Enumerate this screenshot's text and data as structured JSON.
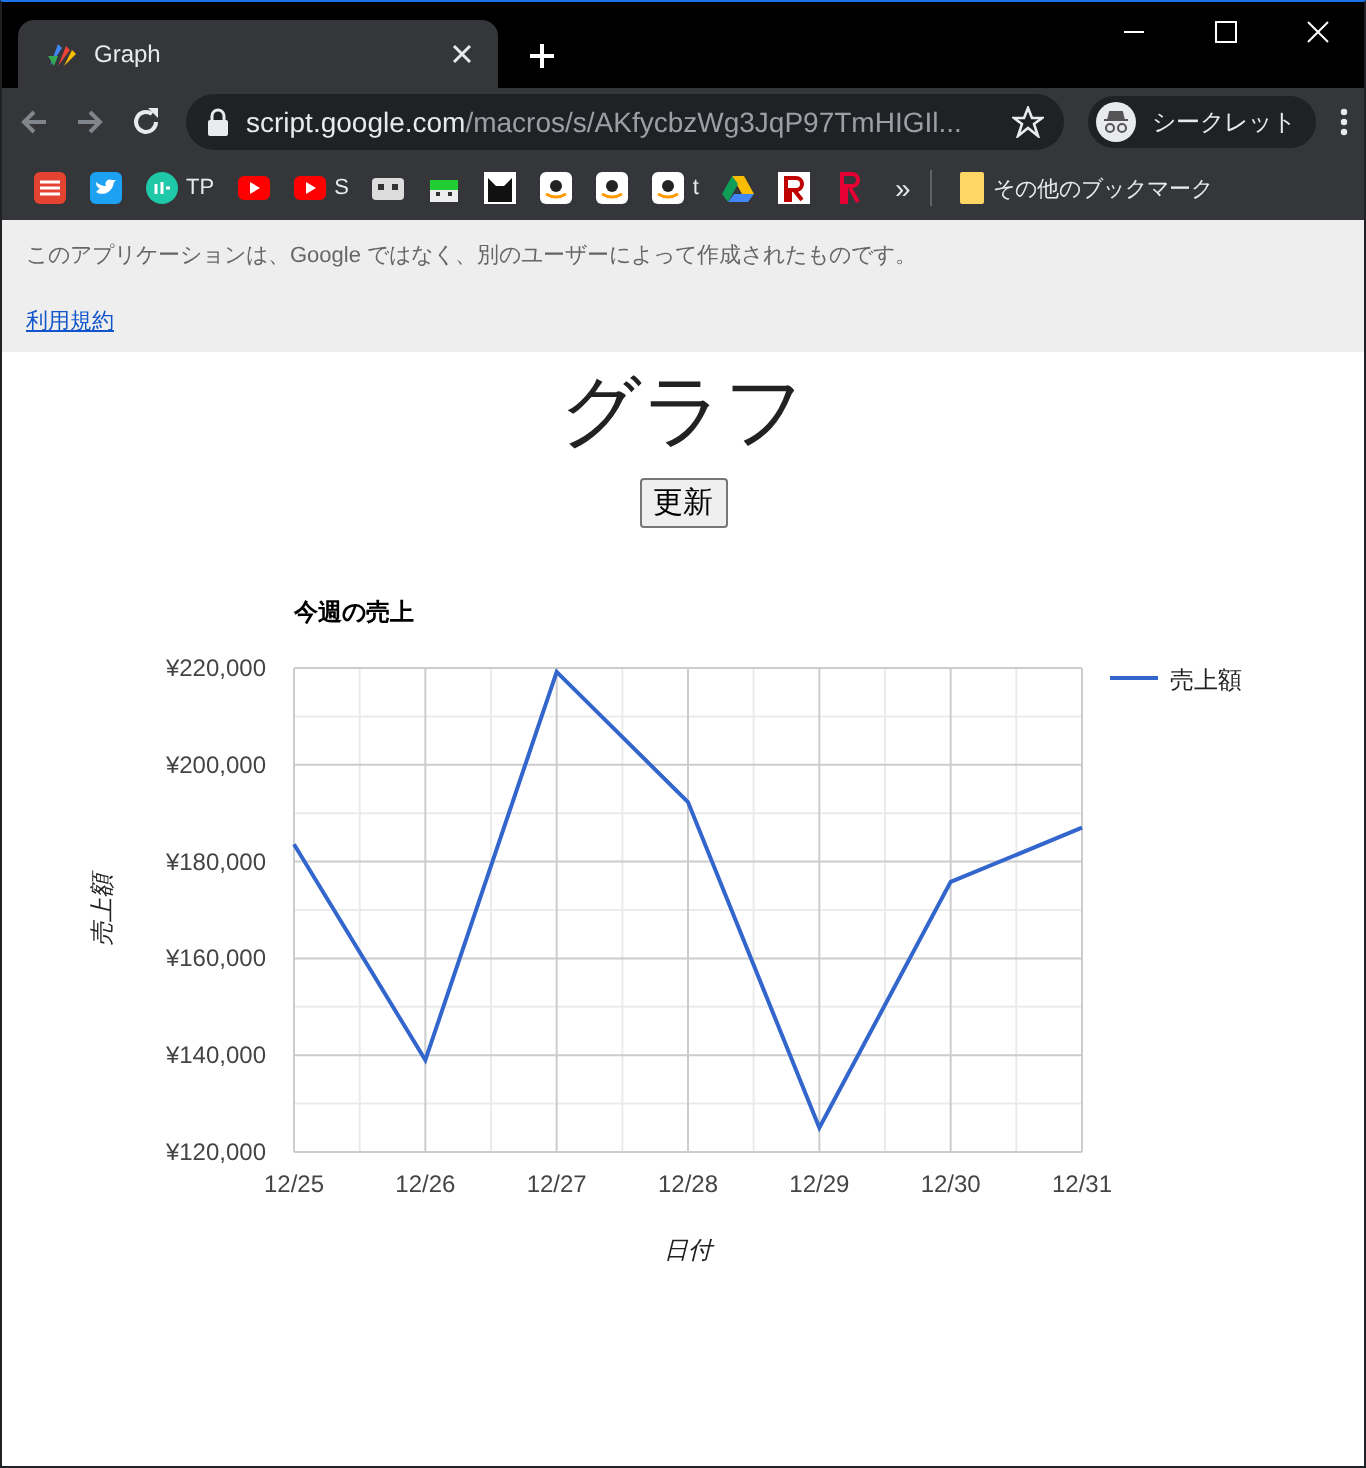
{
  "browser": {
    "tab": {
      "title": "Graph",
      "selected": true
    },
    "address": {
      "host": "script.google.com",
      "path": "/macros/s/AKfycbzWg3JqP97TmHIGIl..."
    },
    "profile": "シークレット",
    "bookmarks": [
      {
        "kind": "list"
      },
      {
        "kind": "bird"
      },
      {
        "kind": "ito",
        "label": "TP"
      },
      {
        "kind": "play"
      },
      {
        "kind": "play",
        "label": "S"
      },
      {
        "kind": "tv"
      },
      {
        "kind": "robot"
      },
      {
        "kind": "cat"
      },
      {
        "kind": "smile"
      },
      {
        "kind": "smile"
      },
      {
        "kind": "smile",
        "label": "t"
      },
      {
        "kind": "drive"
      },
      {
        "kind": "r"
      },
      {
        "kind": "r2"
      }
    ],
    "overflow": "»",
    "other_bookmarks": "その他のブックマーク"
  },
  "notice": {
    "text": "このアプリケーションは、Google ではなく、別のユーザーによって作成されたものです。",
    "link": "利用規約"
  },
  "page": {
    "heading": "グラフ",
    "button": "更新",
    "chart_data": {
      "type": "line",
      "title": "今週の売上",
      "xlabel": "日付",
      "ylabel": "売上額",
      "categories": [
        "12/25",
        "12/26",
        "12/27",
        "12/28",
        "12/29",
        "12/30",
        "12/31"
      ],
      "series": [
        {
          "name": "売上額",
          "color": "#3366cc",
          "values": [
            183600,
            139000,
            219200,
            192300,
            125000,
            175800,
            187000
          ]
        }
      ],
      "ylim": [
        120000,
        220000
      ],
      "grid": true,
      "yticks": [
        {
          "value": 120000,
          "label": "¥120,000"
        },
        {
          "value": 140000,
          "label": "¥140,000"
        },
        {
          "value": 160000,
          "label": "¥160,000"
        },
        {
          "value": 180000,
          "label": "¥180,000"
        },
        {
          "value": 200000,
          "label": "¥200,000"
        },
        {
          "value": 220000,
          "label": "¥220,000"
        }
      ]
    }
  }
}
